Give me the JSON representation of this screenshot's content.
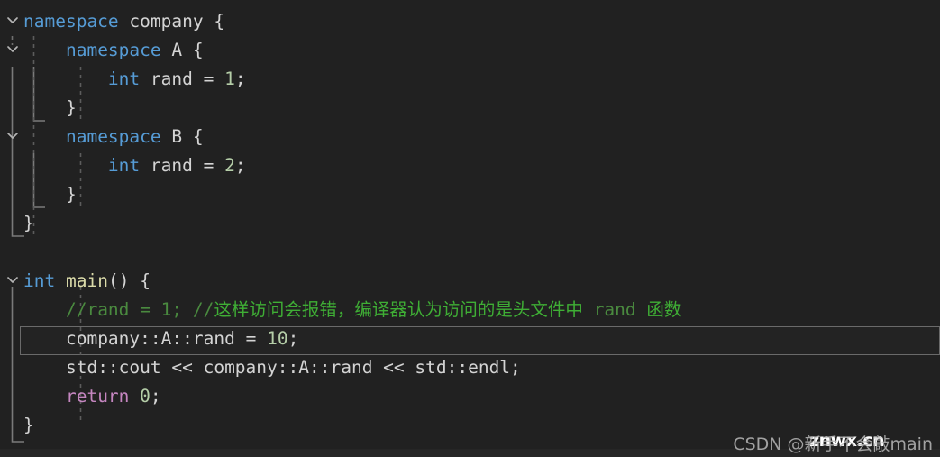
{
  "editor": {
    "background_color": "#212121",
    "default_text_color": "#d4d4d4",
    "font_size_px": 19.5,
    "line_height_px": 32,
    "language": "C++"
  },
  "colors": {
    "keyword": "#569cd6",
    "control_keyword": "#c586c0",
    "function_name": "#dcdcaa",
    "number_literal": "#b5cea8",
    "comment_latin": "#4a8a3f",
    "comment_cjk": "#3fae35",
    "identifier": "#d4d4d4",
    "guide_solid": "#707070",
    "guide_dashed": "#5a5a5a",
    "current_line_border": "#6a6a6a",
    "current_line_background": "#232323",
    "fold_chevron": "#b0b0b0"
  },
  "code": {
    "lines": [
      {
        "index": 1,
        "indent": 0,
        "folded": false,
        "has_fold_chevron": true,
        "tokens": [
          {
            "text": "namespace",
            "type": "keyword"
          },
          {
            "text": " ",
            "type": "plain"
          },
          {
            "text": "company",
            "type": "identifier"
          },
          {
            "text": " ",
            "type": "plain"
          },
          {
            "text": "{",
            "type": "brace"
          }
        ],
        "plain": "namespace company {"
      },
      {
        "index": 2,
        "indent": 1,
        "has_fold_chevron": true,
        "tokens": [
          {
            "text": "    ",
            "type": "plain"
          },
          {
            "text": "namespace",
            "type": "keyword"
          },
          {
            "text": " ",
            "type": "plain"
          },
          {
            "text": "A",
            "type": "identifier"
          },
          {
            "text": " ",
            "type": "plain"
          },
          {
            "text": "{",
            "type": "brace"
          }
        ],
        "plain": "    namespace A {"
      },
      {
        "index": 3,
        "indent": 2,
        "has_fold_chevron": false,
        "tokens": [
          {
            "text": "        ",
            "type": "plain"
          },
          {
            "text": "int",
            "type": "keyword"
          },
          {
            "text": " ",
            "type": "plain"
          },
          {
            "text": "rand",
            "type": "identifier"
          },
          {
            "text": " = ",
            "type": "plain"
          },
          {
            "text": "1",
            "type": "number"
          },
          {
            "text": ";",
            "type": "plain"
          }
        ],
        "plain": "        int rand = 1;"
      },
      {
        "index": 4,
        "indent": 1,
        "has_fold_chevron": false,
        "tokens": [
          {
            "text": "    ",
            "type": "plain"
          },
          {
            "text": "}",
            "type": "brace"
          }
        ],
        "plain": "    }"
      },
      {
        "index": 5,
        "indent": 1,
        "has_fold_chevron": true,
        "tokens": [
          {
            "text": "    ",
            "type": "plain"
          },
          {
            "text": "namespace",
            "type": "keyword"
          },
          {
            "text": " ",
            "type": "plain"
          },
          {
            "text": "B",
            "type": "identifier"
          },
          {
            "text": " ",
            "type": "plain"
          },
          {
            "text": "{",
            "type": "brace"
          }
        ],
        "plain": "    namespace B {"
      },
      {
        "index": 6,
        "indent": 2,
        "has_fold_chevron": false,
        "tokens": [
          {
            "text": "        ",
            "type": "plain"
          },
          {
            "text": "int",
            "type": "keyword"
          },
          {
            "text": " ",
            "type": "plain"
          },
          {
            "text": "rand",
            "type": "identifier"
          },
          {
            "text": " = ",
            "type": "plain"
          },
          {
            "text": "2",
            "type": "number"
          },
          {
            "text": ";",
            "type": "plain"
          }
        ],
        "plain": "        int rand = 2;"
      },
      {
        "index": 7,
        "indent": 1,
        "has_fold_chevron": false,
        "tokens": [
          {
            "text": "    ",
            "type": "plain"
          },
          {
            "text": "}",
            "type": "brace"
          }
        ],
        "plain": "    }"
      },
      {
        "index": 8,
        "indent": 0,
        "has_fold_chevron": false,
        "tokens": [
          {
            "text": "}",
            "type": "brace"
          }
        ],
        "plain": "}"
      },
      {
        "index": 9,
        "indent": 0,
        "has_fold_chevron": false,
        "tokens": [],
        "plain": ""
      },
      {
        "index": 10,
        "indent": 0,
        "has_fold_chevron": true,
        "tokens": [
          {
            "text": "int",
            "type": "keyword"
          },
          {
            "text": " ",
            "type": "plain"
          },
          {
            "text": "main",
            "type": "function"
          },
          {
            "text": "() ",
            "type": "plain"
          },
          {
            "text": "{",
            "type": "brace"
          }
        ],
        "plain": "int main() {"
      },
      {
        "index": 11,
        "indent": 1,
        "has_fold_chevron": false,
        "tokens": [
          {
            "text": "    ",
            "type": "plain"
          },
          {
            "text": "//rand = 1; //",
            "type": "comment_latin"
          },
          {
            "text": "这样访问会报错，编译器认为访问的是头文件中",
            "type": "comment_cjk"
          },
          {
            "text": " rand ",
            "type": "comment_latin"
          },
          {
            "text": "函数",
            "type": "comment_cjk"
          }
        ],
        "plain": "    //rand = 1; //这样访问会报错，编译器认为访问的是头文件中 rand 函数"
      },
      {
        "index": 12,
        "indent": 1,
        "has_fold_chevron": false,
        "is_current_line": true,
        "tokens": [
          {
            "text": "    ",
            "type": "plain"
          },
          {
            "text": "company",
            "type": "identifier"
          },
          {
            "text": "::",
            "type": "plain"
          },
          {
            "text": "A",
            "type": "identifier"
          },
          {
            "text": "::",
            "type": "plain"
          },
          {
            "text": "rand",
            "type": "identifier"
          },
          {
            "text": " = ",
            "type": "plain"
          },
          {
            "text": "10",
            "type": "number"
          },
          {
            "text": ";",
            "type": "plain"
          }
        ],
        "plain": "    company::A::rand = 10;"
      },
      {
        "index": 13,
        "indent": 1,
        "has_fold_chevron": false,
        "tokens": [
          {
            "text": "    ",
            "type": "plain"
          },
          {
            "text": "std::cout << company::A::rand << std::endl;",
            "type": "plain"
          }
        ],
        "plain": "    std::cout << company::A::rand << std::endl;"
      },
      {
        "index": 14,
        "indent": 1,
        "has_fold_chevron": false,
        "tokens": [
          {
            "text": "    ",
            "type": "plain"
          },
          {
            "text": "return",
            "type": "control"
          },
          {
            "text": " ",
            "type": "plain"
          },
          {
            "text": "0",
            "type": "number"
          },
          {
            "text": ";",
            "type": "plain"
          }
        ],
        "plain": "    return 0;"
      },
      {
        "index": 15,
        "indent": 0,
        "has_fold_chevron": false,
        "tokens": [
          {
            "text": "}",
            "type": "brace"
          }
        ],
        "plain": "}"
      }
    ]
  },
  "watermark": {
    "base_text": "CSDN @新手不会敲main",
    "overlay_text": "znwx.cn"
  }
}
